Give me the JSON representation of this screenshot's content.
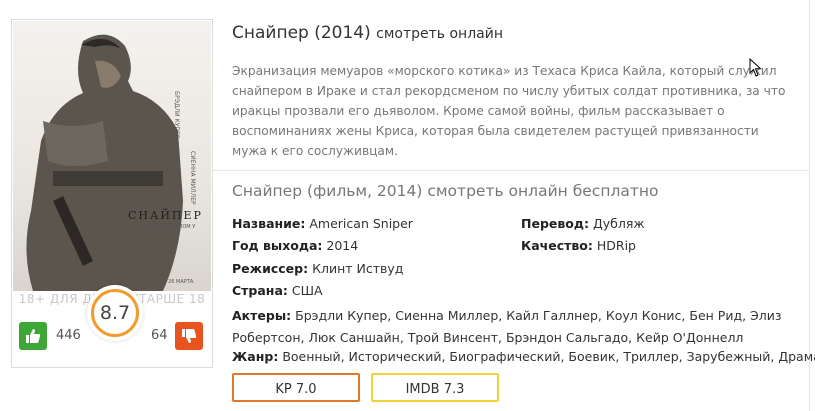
{
  "movie": {
    "title": "Снайпер (2014)",
    "title_suffix": "смотреть онлайн",
    "description": "Экранизация мемуаров «морского котика» из Техаса Криса Кайла, который служил снайпером в Ираке и стал рекордсменом по числу убитых солдат противника, за что иракцы прозвали его дьяволом. Кроме самой войны, фильм рассказывает о воспоминаниях жены Криса, которая была свидетелем растущей привязанности мужа к его сослуживцам.",
    "section_title": "Снайпер (фильм, 2014) смотреть онлайн бесплатно"
  },
  "poster": {
    "caption": "18+ ДЛЯ ДЕТЕЙ СТАРШЕ 18 ЛЕТ",
    "title_text": "СНАЙПЕР",
    "subtitle_text": "ПОЛ ПРИЦЕЛОМ У СМЕРТИ",
    "actor1": "БРЭДЛИ КУПЕР",
    "actor2": "СИЕННА МИЛЛЕР",
    "date": "С 26 МАРТА"
  },
  "rating": {
    "value": "8.7",
    "likes": "446",
    "dislikes": "64"
  },
  "info": {
    "name_label": "Название:",
    "name_value": "American Sniper",
    "year_label": "Год выхода:",
    "year_value": "2014",
    "director_label": "Режиссер:",
    "director_value": "Клинт Иствуд",
    "country_label": "Страна:",
    "country_value": "США",
    "translation_label": "Перевод:",
    "translation_value": "Дубляж",
    "quality_label": "Качество:",
    "quality_value": "HDRip",
    "actors_label": "Актеры:",
    "actors_value": "Брэдли Купер, Сиенна Миллер, Кайл Галлнер, Коул Конис, Бен Рид, Элиз Робертсон, Люк Саншайн, Трой Винсент, Брэндон Сальгадо, Кейр О'Доннелл",
    "genre_label": "Жанр:",
    "genre_value": "Военный, Исторический, Биографический, Боевик, Триллер, Зарубежный, Драма"
  },
  "badges": {
    "kp": "KP 7.0",
    "imdb": "IMDB 7.3"
  },
  "colors": {
    "like": "#3ea637",
    "dislike": "#e8541f",
    "rating_ring": "#f29a2e",
    "kp_border": "#e0782a",
    "imdb_border": "#f0d23a"
  },
  "icons": {
    "like": "thumbs-up-icon",
    "dislike": "thumbs-down-icon",
    "cursor": "mouse-cursor-icon"
  }
}
